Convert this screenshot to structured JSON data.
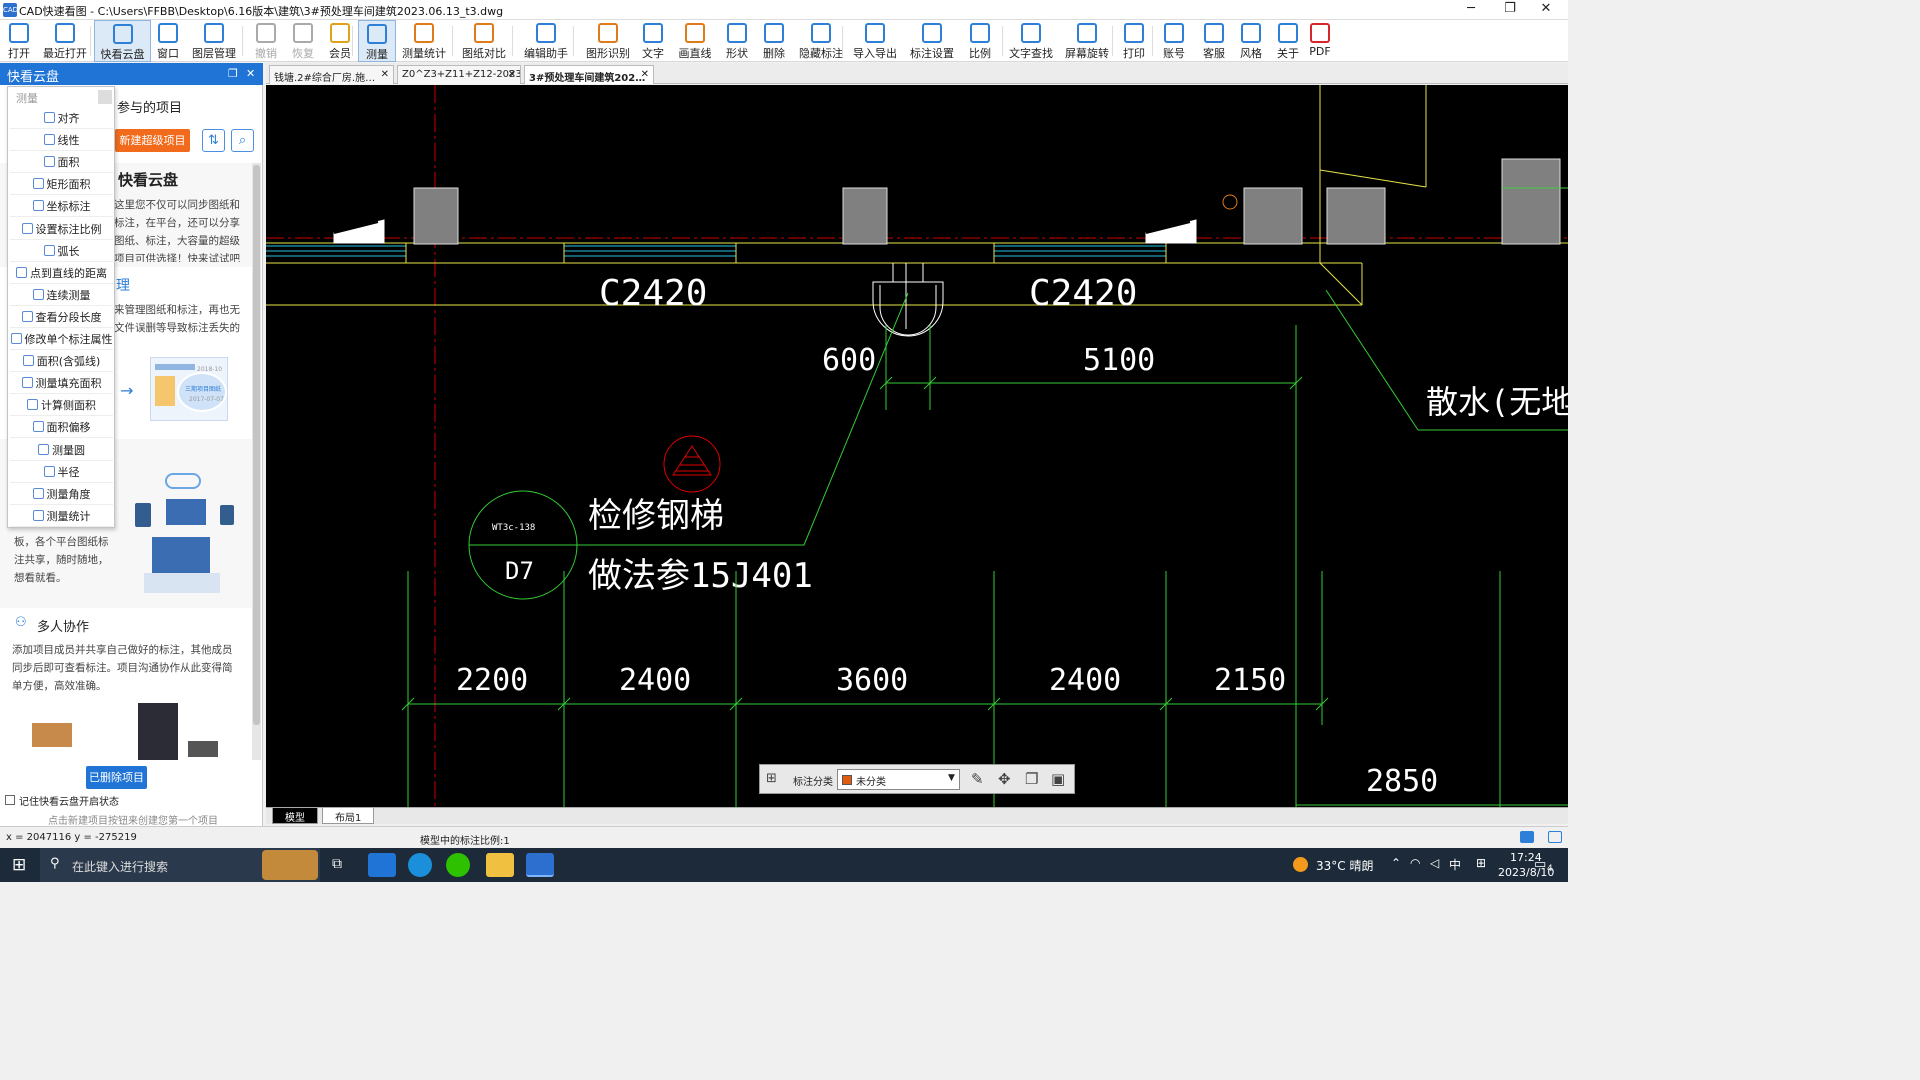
{
  "window": {
    "title": "CAD快速看图 - C:\\Users\\FFBB\\Desktop\\6.16版本\\建筑\\3#预处理车间建筑2023.06.13_t3.dwg",
    "app_icon": "CAD",
    "min": "─",
    "max": "❐",
    "close": "✕"
  },
  "toolbar": {
    "items": [
      {
        "label": "打开",
        "icon": "folder-icon",
        "color": "#2d7fd8"
      },
      {
        "label": "最近打开",
        "icon": "history-icon",
        "color": "#2d7fd8"
      },
      {
        "label": "快看云盘",
        "icon": "cloud-icon",
        "color": "#2d7fd8"
      },
      {
        "label": "窗口",
        "icon": "window-icon",
        "color": "#2d7fd8"
      },
      {
        "label": "图层管理",
        "icon": "layers-icon",
        "color": "#2d7fd8"
      },
      {
        "label": "撤销",
        "icon": "undo-icon",
        "color": "#aaaaaa"
      },
      {
        "label": "恢复",
        "icon": "redo-icon",
        "color": "#aaaaaa"
      },
      {
        "label": "会员",
        "icon": "vip-icon",
        "color": "#e0a21a"
      },
      {
        "label": "测量",
        "icon": "measure-icon",
        "color": "#2d7fd8"
      },
      {
        "label": "测量统计",
        "icon": "stats-icon",
        "color": "#e07b1a"
      },
      {
        "label": "图纸对比",
        "icon": "compare-icon",
        "color": "#e07b1a"
      },
      {
        "label": "编辑助手",
        "icon": "edit-icon",
        "color": "#2d7fd8"
      },
      {
        "label": "图形识别",
        "icon": "recognize-icon",
        "color": "#e07b1a"
      },
      {
        "label": "文字",
        "icon": "text-icon",
        "color": "#2d7fd8"
      },
      {
        "label": "画直线",
        "icon": "line-icon",
        "color": "#e07b1a"
      },
      {
        "label": "形状",
        "icon": "shape-icon",
        "color": "#2d7fd8"
      },
      {
        "label": "删除",
        "icon": "eraser-icon",
        "color": "#2d7fd8"
      },
      {
        "label": "隐藏标注",
        "icon": "eye-icon",
        "color": "#2d7fd8"
      },
      {
        "label": "导入导出",
        "icon": "import-export-icon",
        "color": "#2d7fd8"
      },
      {
        "label": "标注设置",
        "icon": "settings-icon",
        "color": "#2d7fd8"
      },
      {
        "label": "比例",
        "icon": "scale-icon",
        "color": "#2d7fd8"
      },
      {
        "label": "文字查找",
        "icon": "text-search-icon",
        "color": "#2d7fd8"
      },
      {
        "label": "屏幕旋转",
        "icon": "rotate-icon",
        "color": "#2d7fd8"
      },
      {
        "label": "打印",
        "icon": "print-icon",
        "color": "#2d7fd8"
      },
      {
        "label": "账号",
        "icon": "account-icon",
        "color": "#2d7fd8"
      },
      {
        "label": "客服",
        "icon": "headset-icon",
        "color": "#2d7fd8"
      },
      {
        "label": "风格",
        "icon": "style-icon",
        "color": "#2d7fd8"
      },
      {
        "label": "关于",
        "icon": "info-icon",
        "color": "#2d7fd8"
      },
      {
        "label": "PDF",
        "icon": "pdf-icon",
        "color": "#d6282b"
      }
    ]
  },
  "left_panel": {
    "title": "快看云盘",
    "restore_btn": "❐",
    "close_btn": "✕",
    "participated_projects": "参与的项目",
    "new_project_btn": "新建超级项目",
    "section_cloud_title": "快看云盘",
    "section_cloud_text": "这里您不仅可以同步图纸和标注，在平台，还可以分享图纸、标注，大容量的超级项目可供选择！快来试试吧～",
    "section_manage_title": "理",
    "section_manage_text": "来管理图纸和标注，再也无文件误删等导致标注丢失的",
    "project_card_text": "三期项目图纸",
    "project_card_date1": "2018-10",
    "project_card_date2": "2017-07-07",
    "share_text": "板，各个平台图纸标注共享，随时随地，想看就看。",
    "collab_title": "多人协作",
    "collab_text": "添加项目成员并共享自己做好的标注，其他成员同步后即可查看标注。项目沟通协作从此变得简单方便，高效准确。",
    "deleted_btn": "已删除项目",
    "remember_label": "记住快看云盘开启状态",
    "hint": "点击新建项目按钮来创建您第一个项目"
  },
  "measure_menu": {
    "header": "测量",
    "items": [
      "对齐",
      "线性",
      "面积",
      "矩形面积",
      "坐标标注",
      "设置标注比例",
      "弧长",
      "点到直线的距离",
      "连续测量",
      "查看分段长度",
      "修改单个标注属性",
      "面积(含弧线)",
      "测量填充面积",
      "计算侧面积",
      "面积偏移",
      "测量圆",
      "半径",
      "测量角度",
      "测量统计"
    ]
  },
  "doc_tabs": [
    {
      "label": "钱塘.2#综合厂房.施…",
      "active": false
    },
    {
      "label": "Z0^Z3+Z11+Z12-20230…",
      "active": false
    },
    {
      "label": "3#预处理车间建筑202…",
      "active": true
    }
  ],
  "drawing": {
    "window_labels": [
      "C2420",
      "C2420"
    ],
    "dims_top": [
      "600",
      "5100"
    ],
    "dims_bottom": [
      "2200",
      "2400",
      "3600",
      "2400",
      "2150",
      "2850"
    ],
    "note1": "检修钢梯",
    "note2": "做法参15J401",
    "detail_top": "WT3c-138",
    "detail_bottom": "D7",
    "apron_note": "散水(无地"
  },
  "annotation_bar": {
    "label": "标注分类",
    "selected": "未分类",
    "swatch": "#e05a10"
  },
  "sheet_tabs": [
    "模型",
    "布局1"
  ],
  "status_bar": {
    "coords": "x = 2047116  y = -275219",
    "scale": "模型中的标注比例:1"
  },
  "taskbar": {
    "search_placeholder": "在此键入进行搜索",
    "weather": "33°C  晴朗",
    "ime": "中",
    "time": "17:24",
    "date": "2023/8/10",
    "notif_count": "4"
  }
}
